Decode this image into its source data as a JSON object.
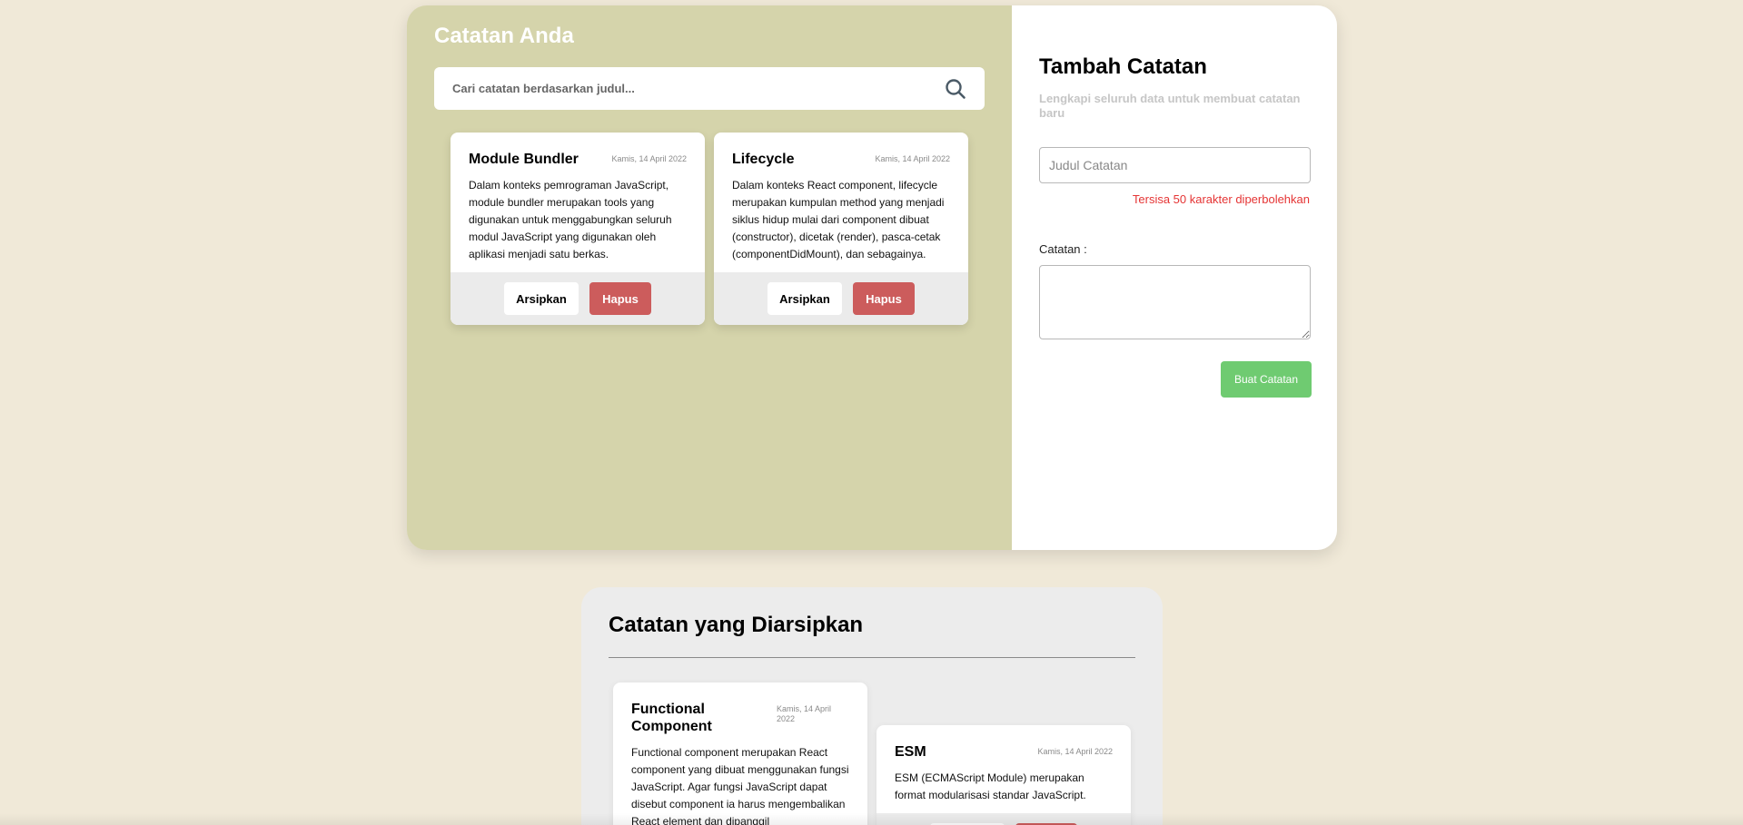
{
  "notes": {
    "title": "Catatan Anda",
    "search_placeholder": "Cari catatan berdasarkan judul...",
    "items": [
      {
        "title": "Module Bundler",
        "date": "Kamis, 14 April 2022",
        "body": "Dalam konteks pemrograman JavaScript, module bundler merupakan tools yang digunakan untuk menggabungkan seluruh modul JavaScript yang digunakan oleh aplikasi menjadi satu berkas.",
        "archive_label": "Arsipkan",
        "delete_label": "Hapus"
      },
      {
        "title": "Lifecycle",
        "date": "Kamis, 14 April 2022",
        "body": "Dalam konteks React component, lifecycle merupakan kumpulan method yang menjadi siklus hidup mulai dari component dibuat (constructor), dicetak (render), pasca-cetak (componentDidMount), dan sebagainya.",
        "archive_label": "Arsipkan",
        "delete_label": "Hapus"
      }
    ]
  },
  "form": {
    "title": "Tambah Catatan",
    "subtitle": "Lengkapi seluruh data untuk membuat catatan baru",
    "title_placeholder": "Judul Catatan",
    "char_counter": "Tersisa 50 karakter diperbolehkan",
    "body_label": "Catatan :",
    "submit_label": "Buat Catatan"
  },
  "archived": {
    "title": "Catatan yang Diarsipkan",
    "items": [
      {
        "title": "Functional Component",
        "date": "Kamis, 14 April 2022",
        "body": "Functional component merupakan React component yang dibuat menggunakan fungsi JavaScript. Agar fungsi JavaScript dapat disebut component ia harus mengembalikan React element dan dipanggil"
      },
      {
        "title": "ESM",
        "date": "Kamis, 14 April 2022",
        "body": "ESM (ECMAScript Module) merupakan format modularisasi standar JavaScript."
      }
    ]
  },
  "colors": {
    "page_bg": "#f0e9d8",
    "notes_panel_bg": "#d5d4ab",
    "delete_button": "#cc5c5c",
    "create_button": "#6fcb71",
    "counter_text": "#e53434"
  }
}
